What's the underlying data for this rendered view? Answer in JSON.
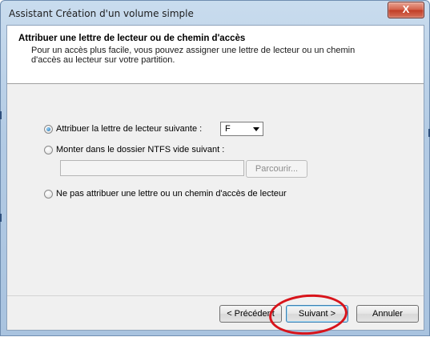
{
  "window": {
    "title": "Assistant Création d'un volume simple",
    "close_glyph": "X"
  },
  "header": {
    "title": "Attribuer une lettre de lecteur ou de chemin d'accès",
    "description": "Pour un accès plus facile, vous pouvez assigner une lettre de lecteur ou un chemin d'accès au lecteur sur votre partition."
  },
  "options": {
    "assign_letter": {
      "label": "Attribuer la lettre de lecteur suivante :",
      "checked": true
    },
    "mount_folder": {
      "label": "Monter dans le dossier NTFS vide suivant :",
      "checked": false
    },
    "no_letter": {
      "label": "Ne pas attribuer une lettre ou un chemin d'accès de lecteur",
      "checked": false
    }
  },
  "drive_letter_select": {
    "value": "F"
  },
  "folder_path_input": {
    "value": ""
  },
  "buttons": {
    "browse": "Parcourir...",
    "back": "< Précédent",
    "next": "Suivant >",
    "cancel": "Annuler"
  },
  "icons": {
    "close": "close-icon",
    "dropdown": "chevron-down-icon"
  },
  "colors": {
    "title_bar": "#b3cbe4",
    "close_button": "#c13d26",
    "highlight_circle": "#d8141b",
    "default_button_border": "#3c7fb1"
  }
}
